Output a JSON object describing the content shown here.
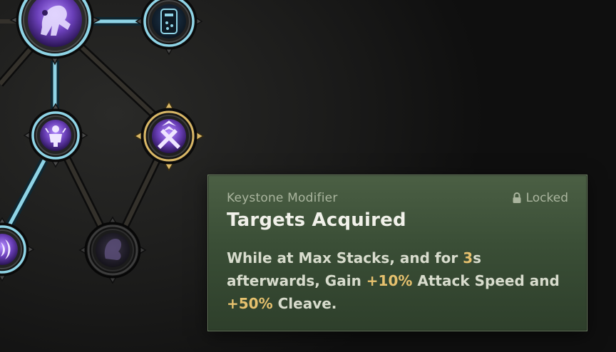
{
  "skill_tree": {
    "nodes": [
      {
        "id": "node-top-left",
        "icon": "beast-figure-icon",
        "state": "unlocked"
      },
      {
        "id": "node-top-right",
        "icon": "rune-tablet-icon",
        "state": "unlocked"
      },
      {
        "id": "node-mid-left",
        "icon": "warrior-rage-icon",
        "state": "unlocked"
      },
      {
        "id": "node-mid-right",
        "icon": "crossed-guns-icon",
        "state": "selected"
      },
      {
        "id": "node-bottom-left",
        "icon": "claw-strike-icon",
        "state": "unlocked"
      },
      {
        "id": "node-bottom-right",
        "icon": "shadow-creature-icon",
        "state": "locked"
      }
    ],
    "colors": {
      "active_link": "#8fd4e6",
      "inactive_link": "#2e2c28",
      "selected_ring": "#d9b766",
      "node_purple": "#6a3fb8"
    }
  },
  "tooltip": {
    "category": "Keystone Modifier",
    "lock_status": "Locked",
    "title": "Targets Acquired",
    "desc": {
      "p1": "While at Max Stacks, and for ",
      "v1": "3",
      "p2": "s afterwards, Gain ",
      "v2": "+10%",
      "p3": " Attack Speed and ",
      "v3": "+50%",
      "p4": " Cleave."
    },
    "colors": {
      "highlight": "#e6c16e",
      "background": "#3f5339"
    }
  }
}
